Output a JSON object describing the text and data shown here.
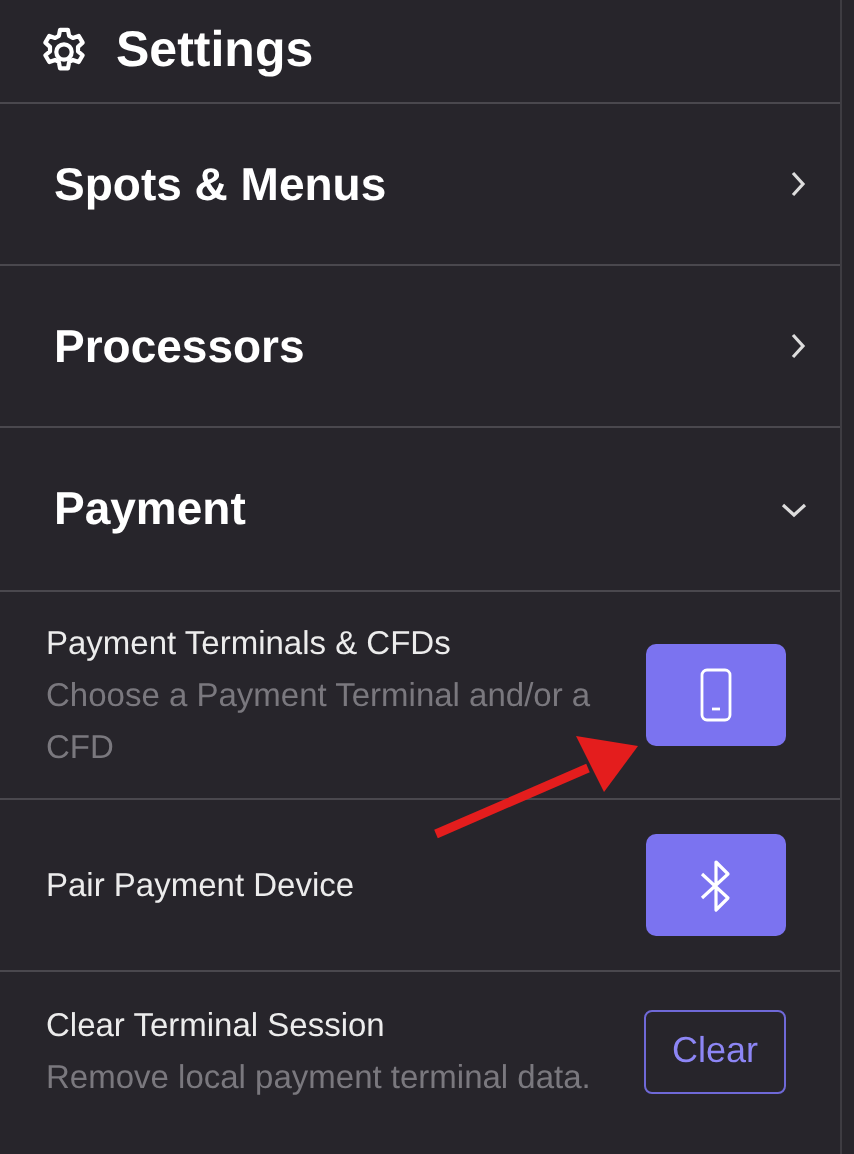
{
  "header": {
    "title": "Settings"
  },
  "sections": [
    {
      "title": "Spots & Menus",
      "expanded": false
    },
    {
      "title": "Processors",
      "expanded": false
    },
    {
      "title": "Payment",
      "expanded": true,
      "items": [
        {
          "kind": "terminal",
          "label": "Payment Terminals & CFDs",
          "description": "Choose a Payment Terminal and/or a CFD"
        },
        {
          "kind": "bluetooth",
          "label": "Pair Payment Device"
        },
        {
          "kind": "clear",
          "label": "Clear Terminal Session",
          "description": "Remove local payment terminal data.",
          "button": "Clear"
        }
      ]
    }
  ]
}
